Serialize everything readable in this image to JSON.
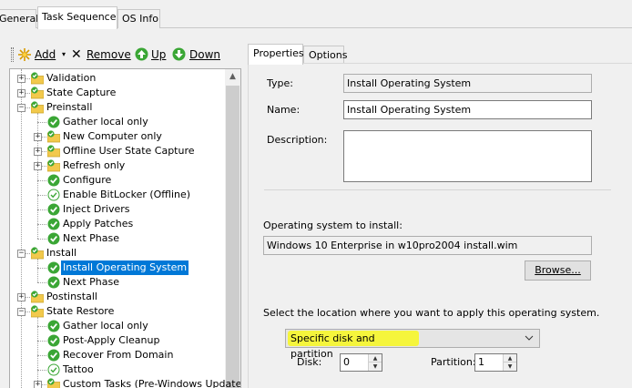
{
  "top_tabs": [
    "General",
    "Task Sequence",
    "OS Info"
  ],
  "toolbar": {
    "add_label": "Add",
    "remove_label": "Remove",
    "up_label": "Up",
    "down_label": "Down"
  },
  "tree": {
    "items": [
      {
        "label": "Validation",
        "icon": "folder-with-check-icon",
        "expander": "+",
        "selected": false
      },
      {
        "label": "State Capture",
        "icon": "folder-with-check-icon",
        "expander": "+",
        "selected": false
      },
      {
        "label": "Preinstall",
        "icon": "folder-with-check-icon",
        "expander": "-",
        "selected": false
      },
      {
        "label": "Gather local only",
        "icon": "green-check-icon",
        "expander": "",
        "selected": false
      },
      {
        "label": "New Computer only",
        "icon": "folder-with-check-icon",
        "expander": "+",
        "selected": false
      },
      {
        "label": "Offline User State Capture",
        "icon": "folder-with-check-icon",
        "expander": "+",
        "selected": false
      },
      {
        "label": "Refresh only",
        "icon": "folder-with-check-icon",
        "expander": "+",
        "selected": false
      },
      {
        "label": "Configure",
        "icon": "green-check-icon",
        "expander": "",
        "selected": false
      },
      {
        "label": "Enable BitLocker (Offline)",
        "icon": "outline-check-icon",
        "expander": "",
        "selected": false
      },
      {
        "label": "Inject Drivers",
        "icon": "green-check-icon",
        "expander": "",
        "selected": false
      },
      {
        "label": "Apply Patches",
        "icon": "green-check-icon",
        "expander": "",
        "selected": false
      },
      {
        "label": "Next Phase",
        "icon": "green-check-icon",
        "expander": "",
        "selected": false
      },
      {
        "label": "Install",
        "icon": "folder-with-check-icon",
        "expander": "-",
        "selected": false
      },
      {
        "label": "Install Operating System",
        "icon": "green-check-icon",
        "expander": "",
        "selected": true
      },
      {
        "label": "Next Phase",
        "icon": "green-check-icon",
        "expander": "",
        "selected": false
      },
      {
        "label": "Postinstall",
        "icon": "folder-with-check-icon",
        "expander": "+",
        "selected": false
      },
      {
        "label": "State Restore",
        "icon": "folder-with-check-icon",
        "expander": "-",
        "selected": false
      },
      {
        "label": "Gather local only",
        "icon": "green-check-icon",
        "expander": "",
        "selected": false
      },
      {
        "label": "Post-Apply Cleanup",
        "icon": "green-check-icon",
        "expander": "",
        "selected": false
      },
      {
        "label": "Recover From Domain",
        "icon": "green-check-icon",
        "expander": "",
        "selected": false
      },
      {
        "label": "Tattoo",
        "icon": "outline-check-icon",
        "expander": "",
        "selected": false
      },
      {
        "label": "Custom Tasks (Pre-Windows Update)",
        "icon": "folder-with-check-icon",
        "expander": "+",
        "selected": false
      }
    ]
  },
  "properties": {
    "tabs": [
      "Properties",
      "Options"
    ],
    "type_label": "Type:",
    "type_value": "Install Operating System",
    "name_label": "Name:",
    "name_value": "Install Operating System",
    "description_label": "Description:",
    "description_value": "",
    "os_label": "Operating system to install:",
    "os_value": "Windows 10 Enterprise in w10pro2004 install.wim",
    "browse_label": "Browse...",
    "location_label": "Select the location where you want to apply this operating system.",
    "location_value": "Specific disk and partition",
    "highlight_color": "#f5f53c",
    "disk_label": "Disk:",
    "disk_value": "0",
    "partition_label": "Partition:",
    "partition_value": "1"
  },
  "colors": {
    "selection": "#0078d7",
    "check_green": "#3aa635",
    "folder_yellow": "#f2c94c"
  }
}
